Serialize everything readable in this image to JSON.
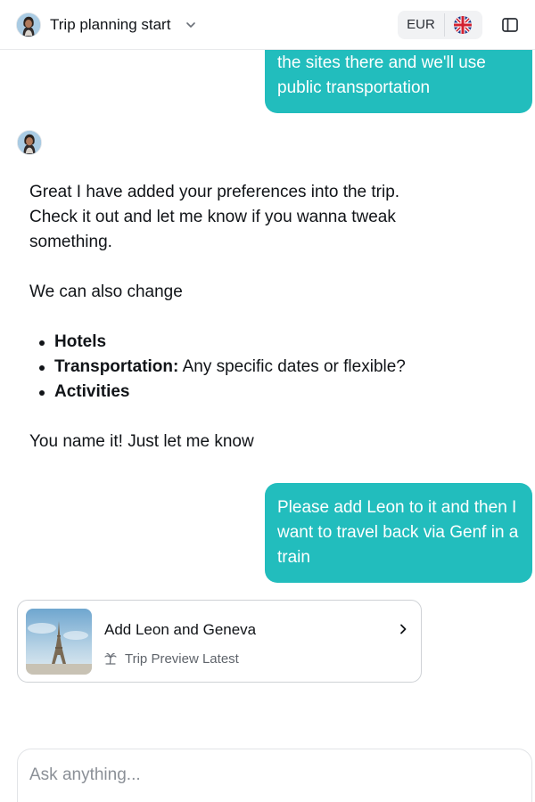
{
  "header": {
    "title": "Trip planning start",
    "currency": "EUR",
    "language_flag": "uk-flag-icon"
  },
  "messages": {
    "user1": "the sites there and we'll use public transportation",
    "bot": {
      "line1": "Great I have added your preferences into the trip. Check it out and let me know if you wanna tweak something.",
      "line2": "We can also change",
      "items": [
        {
          "bold": "Hotels",
          "rest": ""
        },
        {
          "bold": "Transportation:",
          "rest": " Any specific dates or flexible?"
        },
        {
          "bold": "Activities",
          "rest": ""
        }
      ],
      "line3": "You name it! Just let me know"
    },
    "user2": "Please add Leon to it and then I want to travel back via Genf in a train"
  },
  "card": {
    "title": "Add Leon and Geneva",
    "subtitle": "Trip Preview Latest",
    "thumbnail": "eiffel-tower-image"
  },
  "composer": {
    "placeholder": "Ask anything..."
  }
}
